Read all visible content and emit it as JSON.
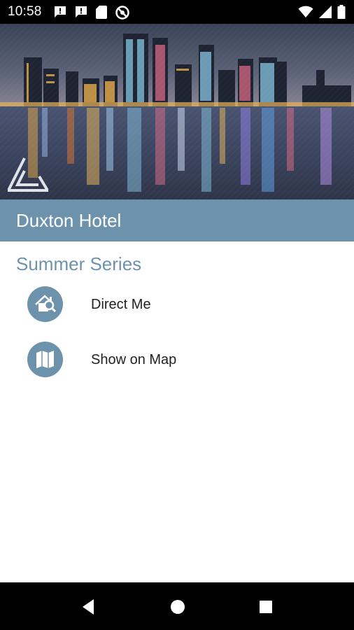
{
  "status_bar": {
    "time": "10:58",
    "left_icons": [
      "chat-notification-icon",
      "chat-notification-icon",
      "sd-card-icon",
      "do-not-disturb-icon"
    ],
    "right_icons": [
      "wifi-icon",
      "cell-signal-icon",
      "battery-icon"
    ]
  },
  "hero": {
    "image": "city-skyline-at-night-photo",
    "logo": "triangle-logo-icon"
  },
  "venue": {
    "title": "Duxton Hotel"
  },
  "event": {
    "name": "Summer Series"
  },
  "actions": [
    {
      "label": "Direct Me",
      "icon": "home-search-icon"
    },
    {
      "label": "Show on Map",
      "icon": "map-icon"
    }
  ],
  "nav_bar": {
    "buttons": [
      "back-icon",
      "home-icon",
      "recents-icon"
    ]
  },
  "colors": {
    "accent": "#6d93ac",
    "status_bar": "#000000",
    "nav_bar": "#000000",
    "text": "#222222"
  }
}
